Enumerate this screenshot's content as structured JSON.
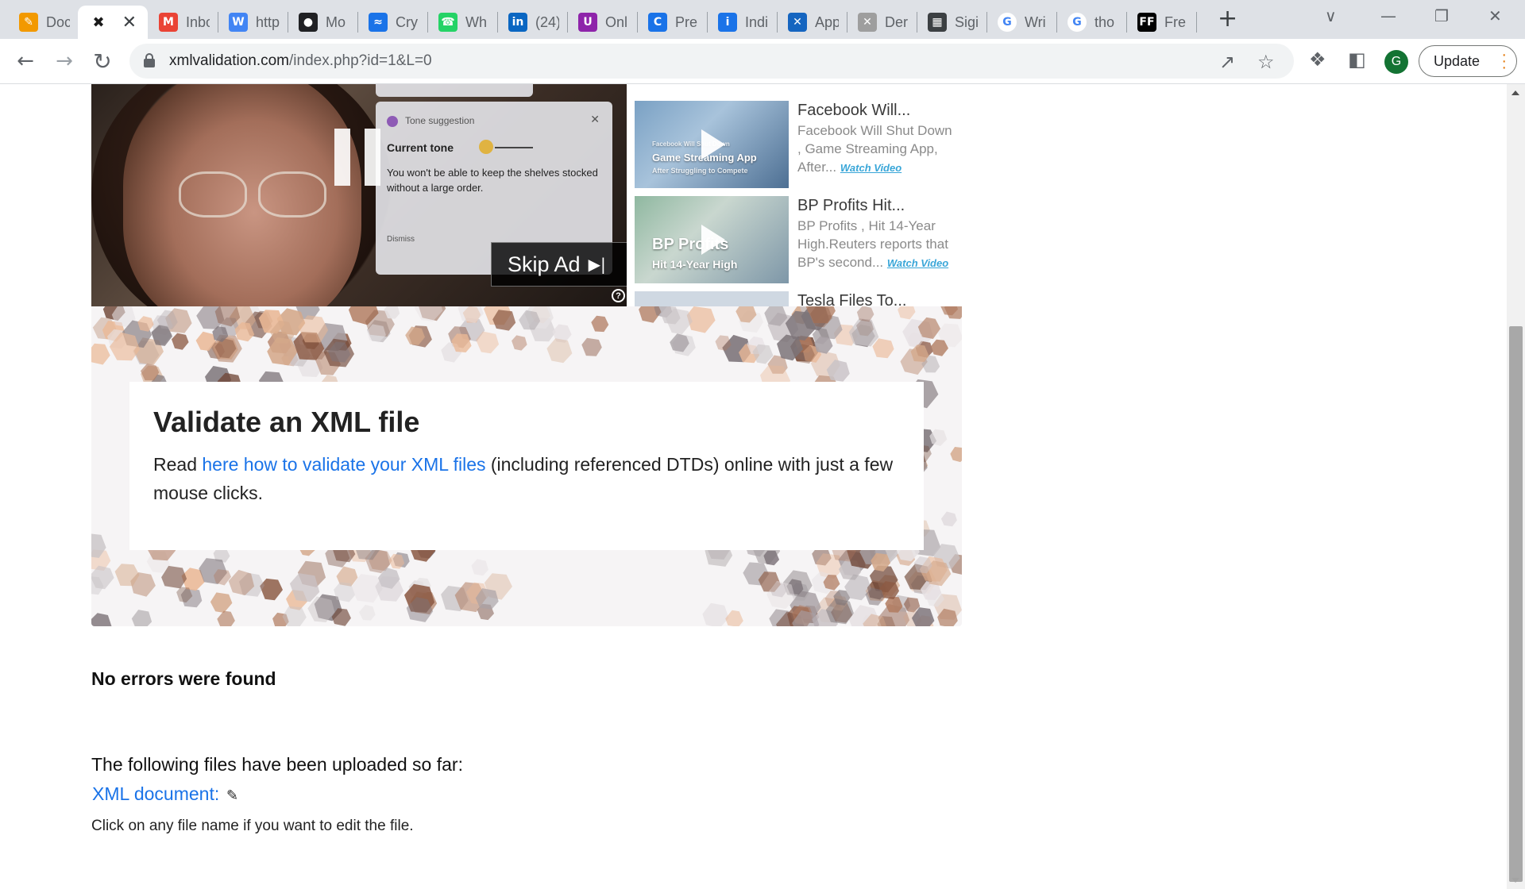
{
  "browser": {
    "tabs": [
      {
        "title": "Doc",
        "icon": "pencil-doc-icon",
        "color": "#f29900"
      },
      {
        "title": "",
        "icon": "xml-validation-icon",
        "color": "#ffffff",
        "active": true
      },
      {
        "title": "Inbo",
        "icon": "gmail-icon",
        "color": "#ea4335"
      },
      {
        "title": "http",
        "icon": "w-logo-icon",
        "color": "#4285f4"
      },
      {
        "title": "Mo",
        "icon": "github-icon",
        "color": "#202124"
      },
      {
        "title": "Cry",
        "icon": "messenger-icon",
        "color": "#1a73e8"
      },
      {
        "title": "Wh",
        "icon": "whatsapp-icon",
        "color": "#25d366"
      },
      {
        "title": "(24)",
        "icon": "linkedin-icon",
        "color": "#0a66c2"
      },
      {
        "title": "Onl",
        "icon": "onlinegdb-icon",
        "color": "#8e24aa"
      },
      {
        "title": "Pre",
        "icon": "c-logo-icon",
        "color": "#1a73e8"
      },
      {
        "title": "Indi",
        "icon": "info-logo-icon",
        "color": "#1a73e8"
      },
      {
        "title": "App",
        "icon": "app-x-icon",
        "color": "#1565c0"
      },
      {
        "title": "Der",
        "icon": "app-x-gray-icon",
        "color": "#9e9e9e"
      },
      {
        "title": "Sigi",
        "icon": "sheets-icon",
        "color": "#3c4043"
      },
      {
        "title": "Wri",
        "icon": "google-icon",
        "color": "#4285f4"
      },
      {
        "title": "tho",
        "icon": "google-icon",
        "color": "#4285f4"
      },
      {
        "title": "Fre",
        "icon": "ff-logo-icon",
        "color": "#000000"
      }
    ],
    "url_host": "xmlvalidation.com",
    "url_path": "/index.php?id=1&L=0",
    "profile_initial": "G",
    "update_label": "Update"
  },
  "ad": {
    "card_title": "Tone suggestion",
    "card_heading": "Current tone",
    "card_body": "You won't be able to keep the shelves stocked without a large order.",
    "card_dismiss": "Dismiss",
    "skip_label": "Skip Ad",
    "help_label": "?"
  },
  "related": [
    {
      "title": "Facebook Will...",
      "description": "Facebook Will Shut Down , Game Streaming App, After...",
      "watch": "Watch Video",
      "thumb_caption_top": "Facebook Will Shut Down",
      "thumb_caption_main": "Game Streaming App",
      "thumb_caption_bottom": "After Struggling to Compete"
    },
    {
      "title": "BP Profits Hit...",
      "description": "BP Profits , Hit 14-Year High.Reuters reports that BP's second...",
      "watch": "Watch Video",
      "thumb_caption_main": "BP Profits",
      "thumb_caption_bottom": "Hit 14-Year High"
    },
    {
      "title": "Tesla Files To..."
    }
  ],
  "hero": {
    "title": "Validate an XML file",
    "text_before": "Read ",
    "link_text": "here how to validate your XML files",
    "text_after": " (including referenced DTDs) online with just a few mouse clicks."
  },
  "results": {
    "status": "No errors were found",
    "uploaded_heading": "The following files have been uploaded so far:",
    "document_link": "XML document:",
    "hint": "Click on any file name if you want to edit the file."
  }
}
